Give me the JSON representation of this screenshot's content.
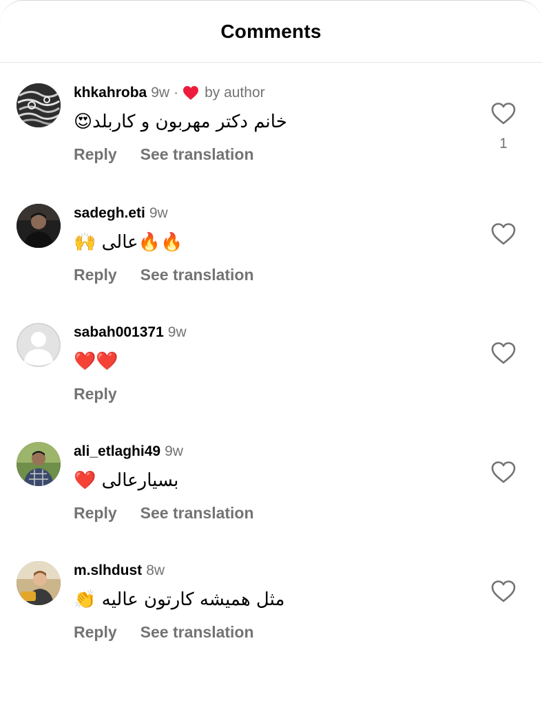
{
  "header": {
    "title": "Comments"
  },
  "colors": {
    "secondary_text": "#737373",
    "heart_red": "#ed1c3c"
  },
  "comments": [
    {
      "username": "khkahroba",
      "time": "9w",
      "separator": "·",
      "by_author": "by author",
      "text": "خانم دکتر مهربون و کاربلد😍",
      "reply": "Reply",
      "translate": "See translation",
      "likes": "1",
      "avatar_icon": "avatar-pattern"
    },
    {
      "username": "sadegh.eti",
      "time": "9w",
      "text": "🔥🔥عالی 🙌",
      "reply": "Reply",
      "translate": "See translation",
      "avatar_icon": "avatar-photo"
    },
    {
      "username": "sabah001371",
      "time": "9w",
      "text": "❤️❤️",
      "reply": "Reply",
      "avatar_icon": "default-avatar-icon"
    },
    {
      "username": "ali_etlaghi49",
      "time": "9w",
      "text": "بسیارعالی ❤️",
      "reply": "Reply",
      "translate": "See translation",
      "avatar_icon": "avatar-photo"
    },
    {
      "username": "m.slhdust",
      "time": "8w",
      "text": "مثل همیشه کارتون عالیه 👏",
      "reply": "Reply",
      "translate": "See translation",
      "avatar_icon": "avatar-photo"
    }
  ]
}
